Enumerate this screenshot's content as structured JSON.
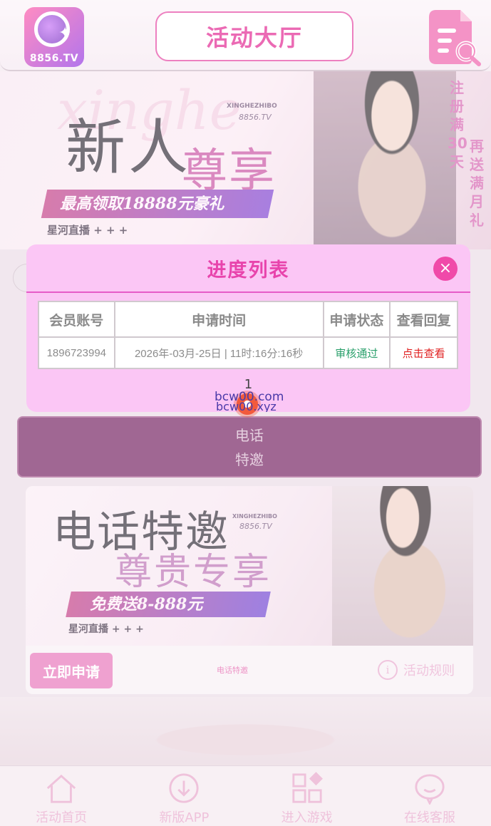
{
  "header": {
    "logo_text": "8856.TV",
    "title": "活动大厅"
  },
  "banner_top": {
    "ghost_text": "xinghe",
    "headline_1": "新人",
    "headline_2": "尊享",
    "brand_small": "XINGHEZHIBO",
    "brand_domain": "8856.TV",
    "ribbon": "最高领取18888元豪礼",
    "subline": "星河直播 + + +",
    "vertical_left": [
      "注",
      "册",
      "满",
      "30",
      "天"
    ],
    "vertical_right": [
      "再",
      "送",
      "满",
      "月",
      "礼"
    ]
  },
  "background_block": {
    "line1": "电话",
    "line2": "特邀"
  },
  "card": {
    "headline_1": "电话特邀",
    "headline_2": "尊贵专享",
    "brand_small": "XINGHEZHIBO",
    "brand_domain": "8856.TV",
    "ribbon": "免费送8-888元",
    "subline": "星河直播 + + +",
    "apply_label": "立即申请",
    "name": "电话特邀",
    "rules_label": "活动规则"
  },
  "bottom_nav": {
    "items": [
      {
        "label": "活动首页",
        "icon": "home-icon"
      },
      {
        "label": "新版APP",
        "icon": "download-icon"
      },
      {
        "label": "进入游戏",
        "icon": "games-grid-icon"
      },
      {
        "label": "在线客服",
        "icon": "chat-bubble-icon"
      }
    ]
  },
  "modal": {
    "title": "进度列表",
    "close_symbol": "×",
    "columns": [
      "会员账号",
      "申请时间",
      "申请状态",
      "查看回复"
    ],
    "rows": [
      {
        "account": "1896723994",
        "time": "2026年-03月-25日 | 11时:16分:16秒",
        "status": "审核通过",
        "reply": "点击查看"
      }
    ],
    "page": "1",
    "watermark_1": "bcw00.com",
    "watermark_2": "bcw00.xyz"
  },
  "colors": {
    "accent": "#e844ac",
    "modal_bg": "#fbc6f5",
    "status_ok": "#2aa06b",
    "reply_link": "#e02020",
    "call_block": "#6e1659"
  }
}
